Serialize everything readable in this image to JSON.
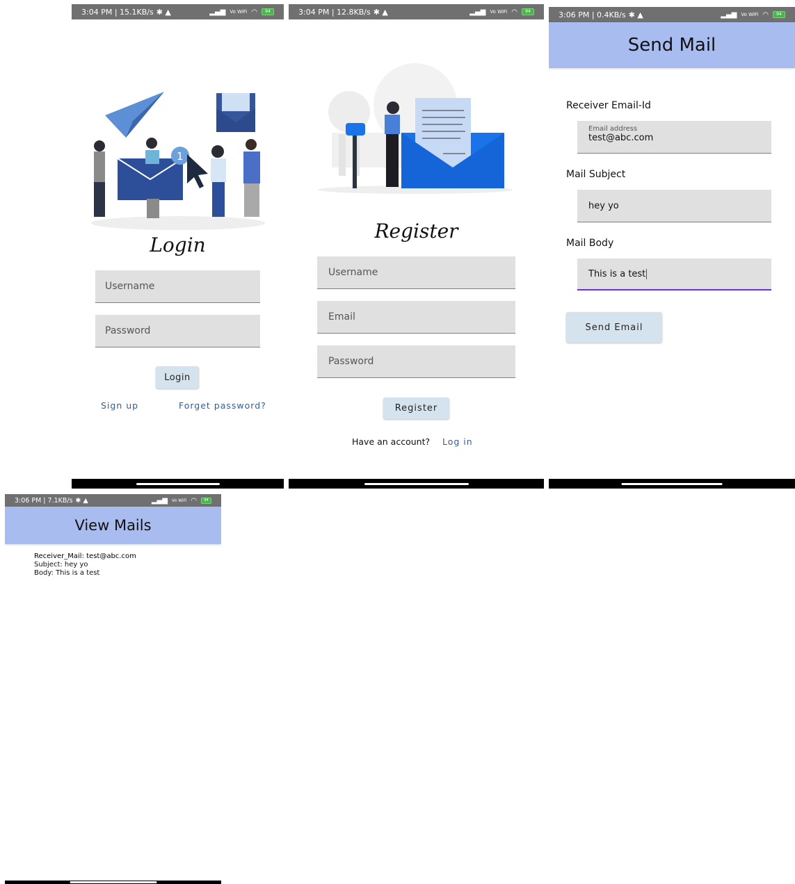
{
  "status_bars": {
    "login": "3:04 PM | 15.1KB/s",
    "register": "3:04 PM | 12.8KB/s",
    "send": "3:06 PM | 0.4KB/s",
    "view": "3:06 PM | 7.1KB/s",
    "battery": "94",
    "network_label": "Vo WiFi"
  },
  "login": {
    "title": "Login",
    "username_placeholder": "Username",
    "password_placeholder": "Password",
    "login_button": "Login",
    "signup_link": "Sign up",
    "forgot_link": "Forget password?"
  },
  "register": {
    "title": "Register",
    "username_placeholder": "Username",
    "email_placeholder": "Email",
    "password_placeholder": "Password",
    "register_button": "Register",
    "have_account": "Have an account?",
    "login_link": "Log in"
  },
  "send_mail": {
    "header": "Send Mail",
    "receiver_label": "Receiver Email-Id",
    "email_hint": "Email address",
    "email_value": "test@abc.com",
    "subject_label": "Mail Subject",
    "subject_value": "hey yo",
    "body_label": "Mail Body",
    "body_value": "This is a test",
    "send_button": "Send Email"
  },
  "view_mails": {
    "header": "View Mails",
    "mail_receiver": "Receiver_Mail: test@abc.com",
    "mail_subject": "Subject: hey yo",
    "mail_body": "Body: This is a test"
  },
  "colors": {
    "header_bar": "#a9bcf0",
    "button": "#d4e3ee",
    "field": "#e0e0e0",
    "link": "#2f5d9a",
    "focus_underline": "#6a2fd6"
  }
}
